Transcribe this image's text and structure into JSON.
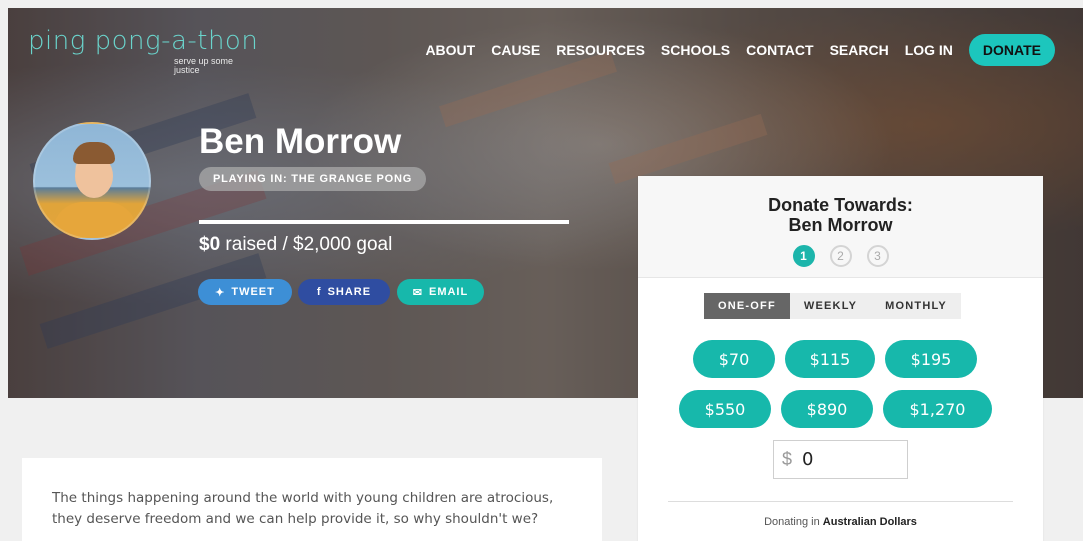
{
  "brand": {
    "logo_text": "ping pong-a-thon",
    "tagline": "serve up some justice"
  },
  "nav": {
    "items": [
      "ABOUT",
      "CAUSE",
      "RESOURCES",
      "SCHOOLS",
      "CONTACT",
      "SEARCH",
      "LOG IN"
    ],
    "donate_label": "DONATE"
  },
  "profile": {
    "name": "Ben Morrow",
    "playing_in": "PLAYING IN: THE GRANGE PONG",
    "raised": "$0",
    "raised_suffix": " raised / $2,000 goal",
    "progress_fraction": 0.0
  },
  "share": {
    "tweet": "TWEET",
    "share": "SHARE",
    "email": "EMAIL"
  },
  "story": "The things happening around the world with young children are atrocious, they deserve freedom and we can help provide it, so why shouldn't we?",
  "donate_panel": {
    "title_line1": "Donate Towards:",
    "title_line2": "Ben Morrow",
    "steps": [
      "1",
      "2",
      "3"
    ],
    "active_step": 1,
    "frequency_tabs": [
      "ONE-OFF",
      "WEEKLY",
      "MONTHLY"
    ],
    "active_frequency": "ONE-OFF",
    "amounts": [
      "$70",
      "$115",
      "$195",
      "$550",
      "$890",
      "$1,270"
    ],
    "custom_currency_symbol": "$",
    "custom_value": "0",
    "currency_prefix": "Donating in ",
    "currency_name": "Australian Dollars"
  },
  "colors": {
    "accent": "#17b8ab",
    "twitter": "#3d8fd6",
    "facebook": "#2f4da1"
  }
}
